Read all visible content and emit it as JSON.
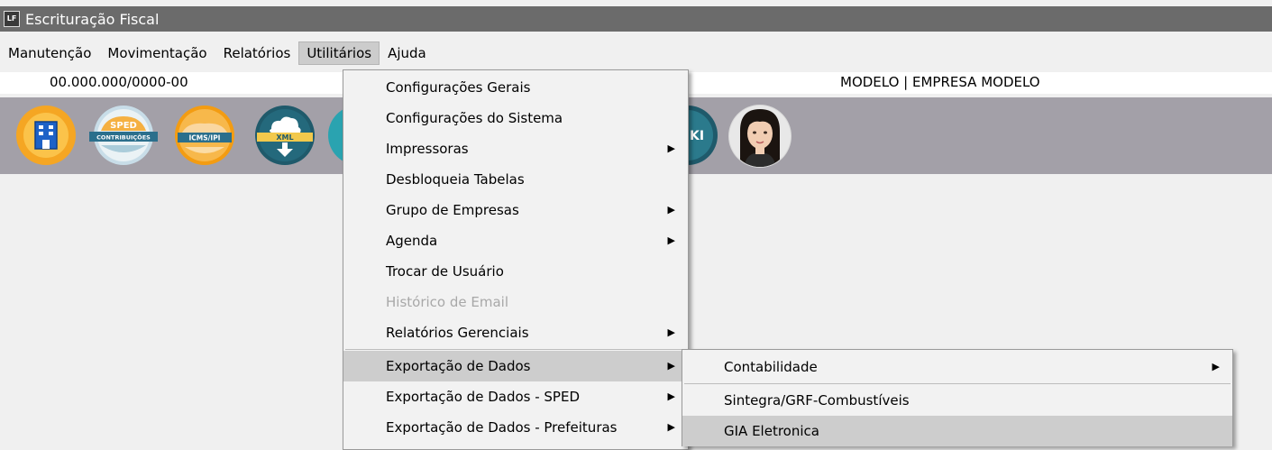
{
  "window": {
    "title": "Escrituração Fiscal",
    "icon_label": "LF"
  },
  "menubar": [
    "Manutenção",
    "Movimentação",
    "Relatórios",
    "Utilitários",
    "Ajuda"
  ],
  "info": {
    "cnpj": "00.000.000/0000-00",
    "company": "MODELO | EMPRESA MODELO"
  },
  "toolbar": {
    "icons": [
      "company-building-icon",
      "sped-contribuicoes-icon",
      "icms-ipi-icon",
      "xml-download-icon",
      "wiki-icon",
      "assistant-avatar-icon"
    ],
    "labels": {
      "sped_top": "SPED",
      "sped_bottom": "CONTRIBUIÇÕES",
      "icms": "ICMS/IPI",
      "xml": "XML",
      "wiki": "KI"
    }
  },
  "utilitarios_menu": {
    "items": [
      {
        "label": "Configurações Gerais"
      },
      {
        "label": "Configurações do Sistema"
      },
      {
        "label": "Impressoras",
        "submenu": true
      },
      {
        "label": "Desbloqueia Tabelas"
      },
      {
        "label": "Grupo de Empresas",
        "submenu": true
      },
      {
        "label": "Agenda",
        "submenu": true
      },
      {
        "label": "Trocar de Usuário"
      },
      {
        "label": "Histórico de Email",
        "disabled": true
      },
      {
        "label": "Relatórios Gerenciais",
        "submenu": true
      },
      {
        "label": "Exportação de Dados",
        "submenu": true,
        "highlighted": true
      },
      {
        "label": "Exportação de Dados - SPED",
        "submenu": true
      },
      {
        "label": "Exportação de Dados - Prefeituras",
        "submenu": true
      }
    ]
  },
  "exportacao_submenu": {
    "items": [
      {
        "label": "Contabilidade",
        "submenu": true
      },
      {
        "label": "Sintegra/GRF-Combustíveis"
      },
      {
        "label": "GIA Eletronica",
        "highlighted": true
      }
    ]
  },
  "colors": {
    "titlebar": "#6b6b6b",
    "toolbar": "#a3a0a8",
    "menu_highlight": "#cdcdcd",
    "icon_orange": "#f5a623",
    "icon_teal": "#1f5a6b"
  }
}
